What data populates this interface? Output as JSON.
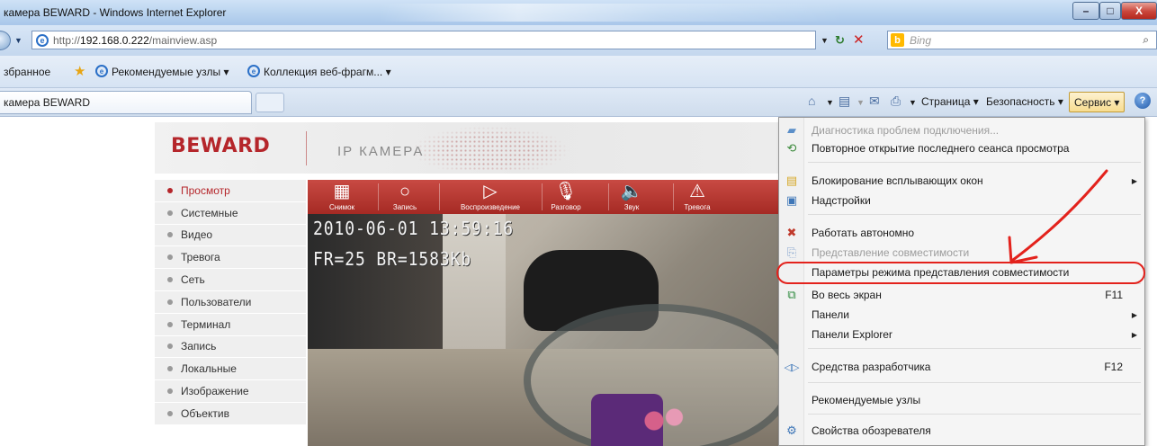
{
  "window": {
    "title": "камера BEWARD - Windows Internet Explorer",
    "min": "–",
    "max": "□",
    "close": "X"
  },
  "address": {
    "url_prefix": "http://",
    "url_host": "192.168.0.222",
    "url_path": "/mainview.asp",
    "search_placeholder": "Bing"
  },
  "favorites": {
    "label": "збранное",
    "recommended": "Рекомендуемые узлы ▾",
    "gallery": "Коллекция веб-фрагм... ▾"
  },
  "tab": {
    "title": "камера BEWARD"
  },
  "commandbar": {
    "page": "Страница ▾",
    "safety": "Безопасность ▾",
    "service": "Сервис ▾"
  },
  "camera": {
    "brand": "BEWARD",
    "title": "IP КАМЕРА",
    "menu": [
      "Просмотр",
      "Системные",
      "Видео",
      "Тревога",
      "Сеть",
      "Пользователи",
      "Терминал",
      "Запись",
      "Локальные",
      "Изображение",
      "Объектив"
    ],
    "toolbar": [
      {
        "label": "Снимок",
        "icon": "filmstrip-icon"
      },
      {
        "label": "Запись",
        "icon": "record-icon"
      },
      {
        "label": "Воспроизведение",
        "icon": "play-icon"
      },
      {
        "label": "Разговор",
        "icon": "microphone-icon"
      },
      {
        "label": "Звук",
        "icon": "speaker-icon"
      },
      {
        "label": "Тревога",
        "icon": "alarm-icon"
      }
    ],
    "osd_time": "2010-06-01 13:59:16",
    "osd_stats": "FR=25 BR=1583Kb"
  },
  "service_menu": {
    "items": [
      {
        "label": "Диагностика проблем подключения...",
        "disabled": true,
        "icon": "diagnostics-icon"
      },
      {
        "label": "Повторное открытие последнего сеанса просмотра",
        "disabled": false,
        "icon": "reopen-session-icon"
      },
      {
        "label": "Блокирование всплывающих окон",
        "disabled": false,
        "submenu": true,
        "icon": "popup-blocker-icon"
      },
      {
        "label": "Надстройки",
        "disabled": false,
        "icon": "addons-icon"
      },
      {
        "label": "Работать автономно",
        "disabled": false,
        "icon": "offline-icon"
      },
      {
        "label": "Представление совместимости",
        "disabled": true,
        "icon": "compat-view-icon"
      },
      {
        "label": "Параметры режима представления совместимости",
        "disabled": false,
        "highlighted": true
      },
      {
        "label": "Во весь экран",
        "shortcut": "F11",
        "disabled": false,
        "icon": "fullscreen-icon"
      },
      {
        "label": "Панели",
        "submenu": true,
        "disabled": false
      },
      {
        "label": "Панели Explorer",
        "submenu": true,
        "disabled": false
      },
      {
        "label": "Средства разработчика",
        "shortcut": "F12",
        "disabled": false,
        "icon": "developer-tools-icon"
      },
      {
        "label": "Рекомендуемые узлы",
        "disabled": false
      },
      {
        "label": "Свойства обозревателя",
        "disabled": false,
        "icon": "internet-options-icon"
      }
    ]
  },
  "colors": {
    "brand_red": "#b5262b",
    "annotation_red": "#e3221c"
  }
}
